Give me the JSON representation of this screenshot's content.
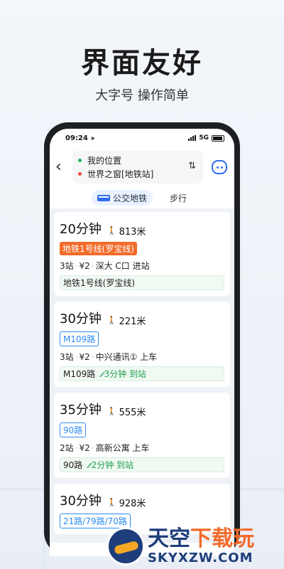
{
  "promo": {
    "headline": "界面友好",
    "subline": "大字号 操作简单"
  },
  "status_bar": {
    "time": "09:24",
    "network": "5G"
  },
  "route": {
    "origin": "我的位置",
    "destination": "世界之窗[地铁站]",
    "swap_icon": "swap-icon",
    "assistant_icon": "assistant-icon"
  },
  "tabs": [
    {
      "label": "公交地铁",
      "active": true
    },
    {
      "label": "步行",
      "active": false
    }
  ],
  "results": [
    {
      "duration": "20分钟",
      "walk": "813米",
      "line_tag": "地铁1号线(罗宝线)",
      "tag_type": "metro",
      "stops": "3站",
      "price": "¥2",
      "board": "深大 C口 进站",
      "hint_line": "地铁1号线(罗宝线)",
      "hint_eta": ""
    },
    {
      "duration": "30分钟",
      "walk": "221米",
      "line_tag": "M109路",
      "tag_type": "bus",
      "stops": "3站",
      "price": "¥2",
      "board": "中兴通讯① 上车",
      "hint_line": "M109路",
      "hint_eta": "3分钟 到站"
    },
    {
      "duration": "35分钟",
      "walk": "555米",
      "line_tag": "90路",
      "tag_type": "bus",
      "stops": "2站",
      "price": "¥2",
      "board": "高新公寓 上车",
      "hint_line": "90路",
      "hint_eta": "2分钟 到站"
    },
    {
      "duration": "30分钟",
      "walk": "928米",
      "line_tag": "21路/79路/70路",
      "tag_type": "bus"
    }
  ],
  "watermark": {
    "title_a": "天空",
    "title_b": "下载玩",
    "sub": "SKYXZW.COM"
  },
  "colors": {
    "metro": "#f26b2a",
    "bus": "#2f8cf0",
    "eta": "#20a04f",
    "accent": "#2f6cf6"
  }
}
